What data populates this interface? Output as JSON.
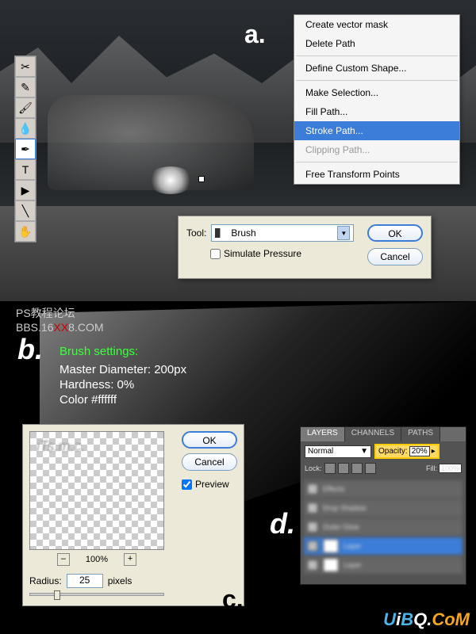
{
  "labels": {
    "a": "a.",
    "b": "b.",
    "c": "c.",
    "d": "d."
  },
  "context_menu": {
    "items": [
      {
        "label": "Create vector mask",
        "state": "normal"
      },
      {
        "label": "Delete Path",
        "state": "normal"
      },
      {
        "label": "Define Custom Shape...",
        "state": "normal"
      },
      {
        "label": "Make Selection...",
        "state": "normal"
      },
      {
        "label": "Fill Path...",
        "state": "normal"
      },
      {
        "label": "Stroke Path...",
        "state": "selected"
      },
      {
        "label": "Clipping Path...",
        "state": "disabled"
      },
      {
        "label": "Free Transform Points",
        "state": "normal"
      }
    ]
  },
  "stroke_dialog": {
    "tool_label": "Tool:",
    "tool_value": "Brush",
    "simulate_label": "Simulate Pressure",
    "ok": "OK",
    "cancel": "Cancel"
  },
  "watermark": {
    "line1": "PS教程论坛",
    "prefix": "BBS.16",
    "xx": "XX",
    "suffix": "8.COM"
  },
  "brush_settings": {
    "title": "Brush settings:",
    "diameter": "Master Diameter: 200px",
    "hardness": "Hardness: 0%",
    "color": "Color #ffffff"
  },
  "gauss": {
    "ok": "OK",
    "cancel": "Cancel",
    "preview": "Preview",
    "minus": "–",
    "zoom": "100%",
    "plus": "+",
    "radius_label": "Radius:",
    "radius_value": "25",
    "pixels": "pixels",
    "preview_text": "iTs.m.c."
  },
  "layers": {
    "tabs": [
      "LAYERS",
      "CHANNELS",
      "PATHS"
    ],
    "blend": "Normal",
    "opacity_label": "Opacity:",
    "opacity_value": "20%",
    "lock_label": "Lock:",
    "fill_label": "Fill:",
    "fill_value": "100%"
  },
  "uibq": {
    "u": "U",
    "i": "i",
    "b": "B",
    "q": "Q",
    "dot": ".",
    "c": "C",
    "o": "o",
    "m": "M"
  }
}
